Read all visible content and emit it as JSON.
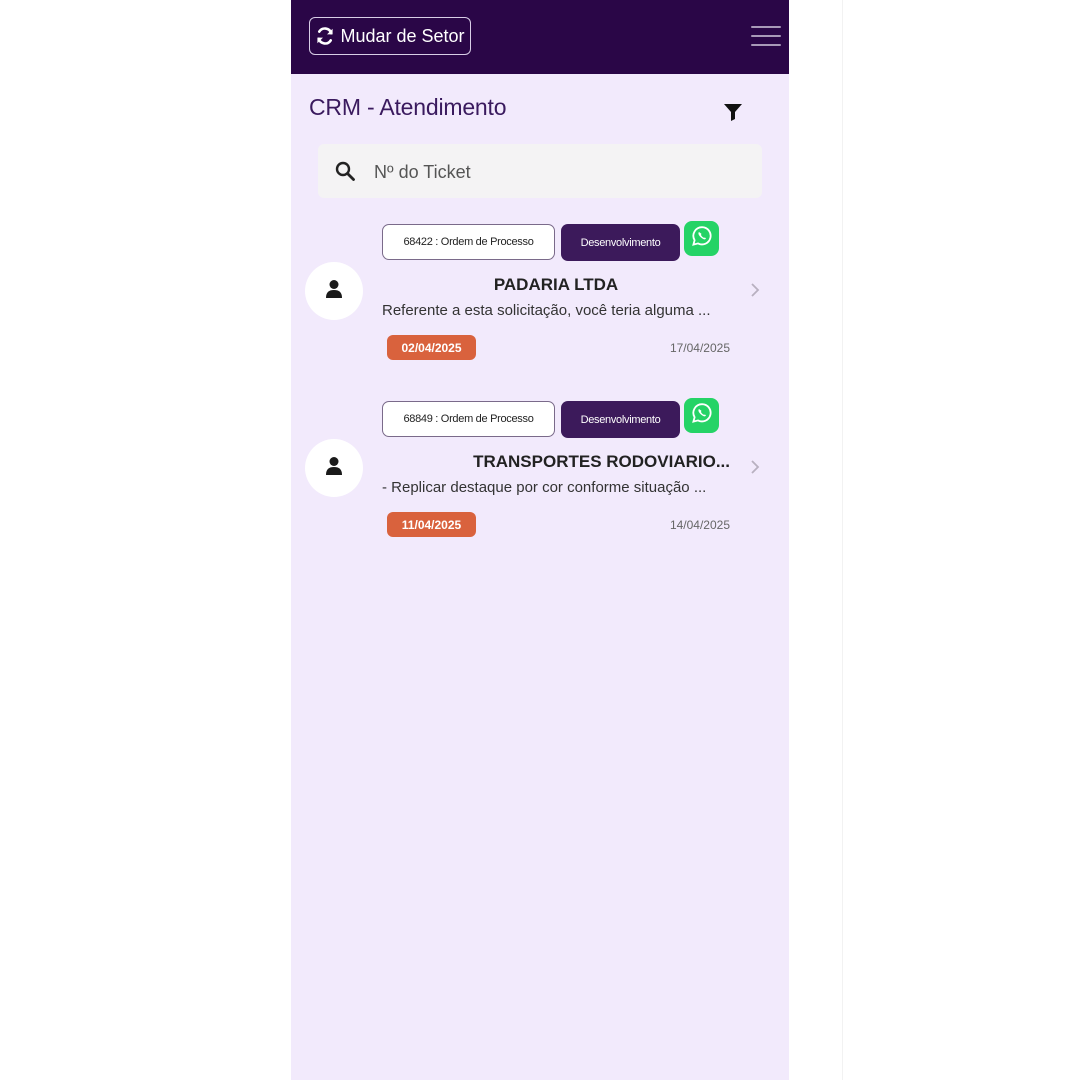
{
  "header": {
    "change_sector_label": "Mudar de Setor"
  },
  "page": {
    "title": "CRM - Atendimento"
  },
  "search": {
    "placeholder": "Nº do Ticket",
    "value": ""
  },
  "tickets": [
    {
      "number_label": "68422 : Ordem de Processo",
      "sector": "Desenvolvimento",
      "client": "PADARIA LTDA",
      "description": "Referente a esta solicitação, você teria alguma ...",
      "badge_date": "02/04/2025",
      "date": "17/04/2025"
    },
    {
      "number_label": "68849 : Ordem de Processo",
      "sector": "Desenvolvimento",
      "client": "TRANSPORTES RODOVIARIO...",
      "description": "- Replicar destaque por cor conforme situação ...",
      "badge_date": "11/04/2025",
      "date": "14/04/2025"
    }
  ],
  "colors": {
    "header_bg": "#2a0647",
    "page_bg": "#f2eafc",
    "sector_tag": "#3c1a5b",
    "date_badge": "#d9623d",
    "whatsapp": "#25d366"
  },
  "icons": {
    "change_sector": "refresh-icon",
    "menu": "hamburger-icon",
    "filter": "filter-icon",
    "search": "search-icon",
    "avatar": "user-icon",
    "whatsapp": "whatsapp-icon",
    "chevron": "chevron-right-icon"
  }
}
